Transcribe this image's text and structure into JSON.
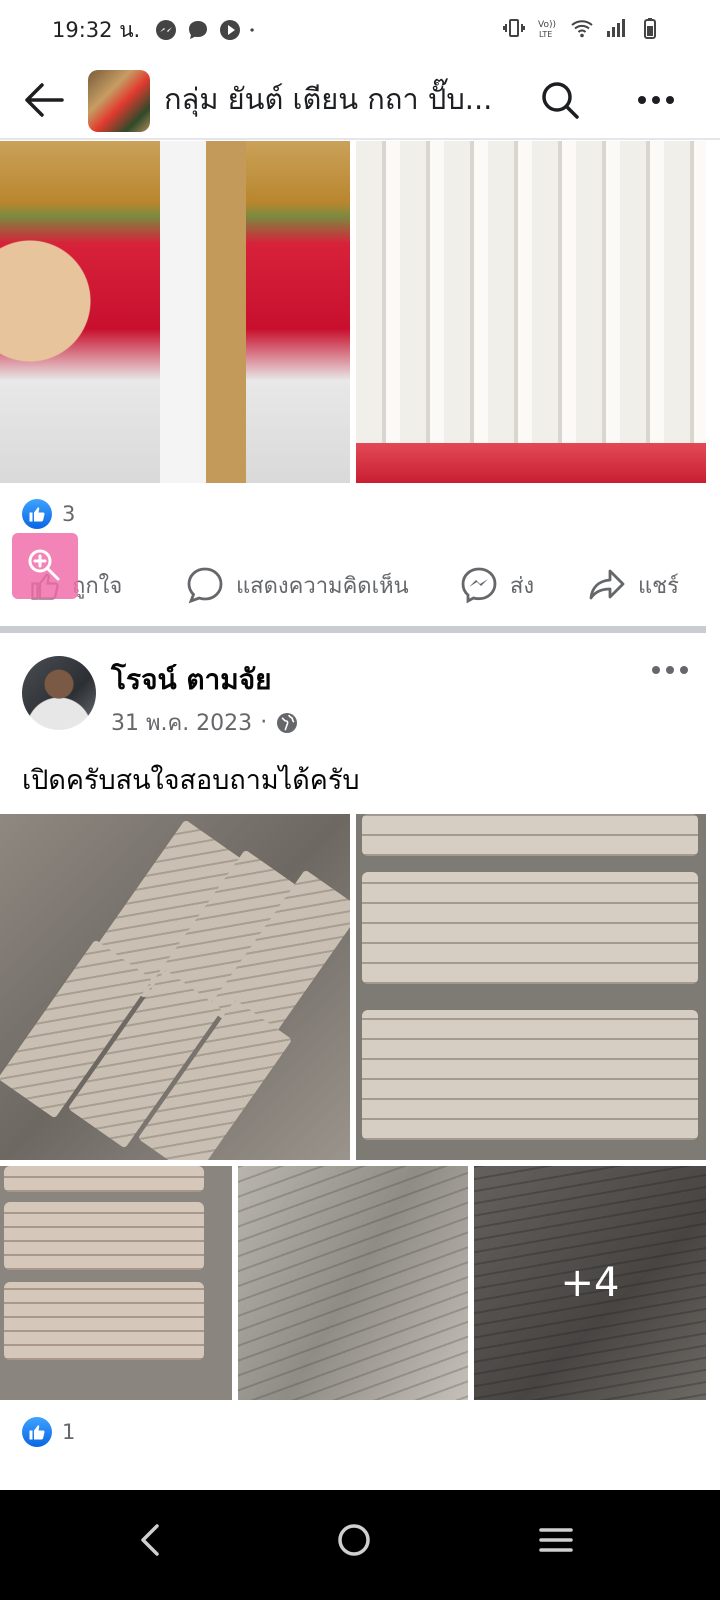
{
  "status_bar": {
    "time": "19:32 น.",
    "left_icons": [
      "messenger-icon",
      "chat-icon",
      "play-icon",
      "dot-icon"
    ],
    "right_icons": [
      "vibrate-icon",
      "volte-icon",
      "wifi-icon",
      "signal-icon",
      "battery-icon"
    ]
  },
  "header": {
    "group_name": "กลุ่ม ยันต์ เตียน กถา ปั๊บ...",
    "back_icon": "back-arrow-icon",
    "search_icon": "search-icon",
    "more_icon": "more-icon"
  },
  "post1": {
    "like_count": "3",
    "actions": {
      "like": "ถูกใจ",
      "comment": "แสดงความคิดเห็น",
      "send": "ส่ง",
      "share": "แชร์"
    }
  },
  "post2": {
    "author": "โรจน์ ตามจัย",
    "date": "31 พ.ค. 2023",
    "separator": "·",
    "text": "เปิดครับสนใจสอบถามได้ครับ",
    "more_photos": "+4",
    "like_count": "1"
  },
  "colors": {
    "facebook_blue": "#0a66e4",
    "secondary_text": "#65676b"
  },
  "nav": [
    "nav-back-icon",
    "nav-home-icon",
    "nav-recents-icon"
  ]
}
